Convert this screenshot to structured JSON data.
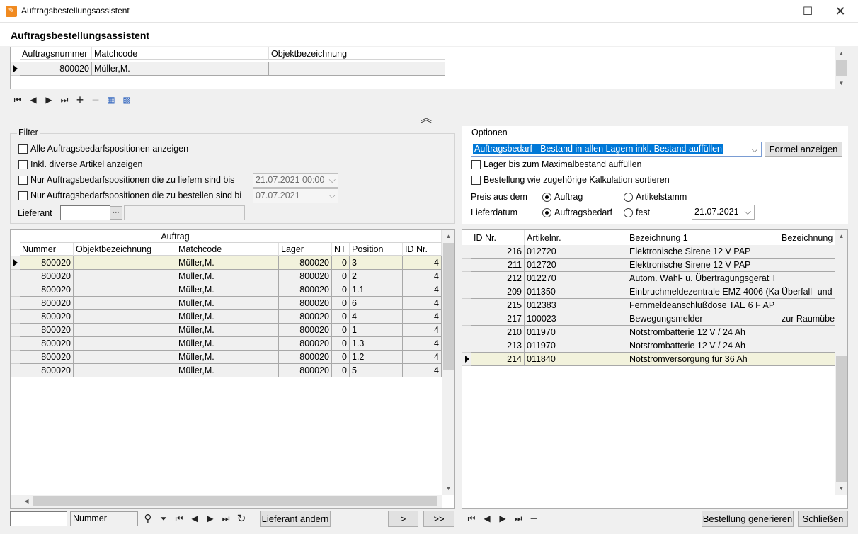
{
  "window": {
    "title": "Auftragsbestellungsassistent",
    "icon": "app-logo-icon"
  },
  "header": {
    "title": "Auftragsbestellungsassistent"
  },
  "order_grid": {
    "columns": [
      "Auftragsnummer",
      "Matchcode",
      "Objektbezeichnung"
    ],
    "rows": [
      {
        "auftragsnummer": "800020",
        "matchcode": "Müller,M.",
        "objektbezeichnung": ""
      }
    ]
  },
  "filter": {
    "legend": "Filter",
    "cb_all": "Alle Auftragsbedarfspositionen anzeigen",
    "cb_diverse": "Inkl. diverse Artikel anzeigen",
    "cb_liefern": "Nur Auftragsbedarfspositionen die zu liefern sind bis",
    "cb_bestellen": "Nur Auftragsbedarfspositionen die zu bestellen sind bi",
    "date_liefern": "21.07.2021 00:00",
    "date_bestellen": "07.07.2021",
    "lieferant_label": "Lieferant",
    "lieferant_browse": "···"
  },
  "left_grid": {
    "group_header": "Auftrag",
    "columns": [
      "Nummer",
      "Objektbezeichnung",
      "Matchcode",
      "Lager",
      "NT",
      "Position",
      "ID Nr."
    ],
    "rows": [
      {
        "nummer": "800020",
        "objekt": "",
        "matchcode": "Müller,M.",
        "lager": "800020",
        "nt": "0",
        "position": "3",
        "id": "4"
      },
      {
        "nummer": "800020",
        "objekt": "",
        "matchcode": "Müller,M.",
        "lager": "800020",
        "nt": "0",
        "position": "2",
        "id": "4"
      },
      {
        "nummer": "800020",
        "objekt": "",
        "matchcode": "Müller,M.",
        "lager": "800020",
        "nt": "0",
        "position": "1.1",
        "id": "4"
      },
      {
        "nummer": "800020",
        "objekt": "",
        "matchcode": "Müller,M.",
        "lager": "800020",
        "nt": "0",
        "position": "6",
        "id": "4"
      },
      {
        "nummer": "800020",
        "objekt": "",
        "matchcode": "Müller,M.",
        "lager": "800020",
        "nt": "0",
        "position": "4",
        "id": "4"
      },
      {
        "nummer": "800020",
        "objekt": "",
        "matchcode": "Müller,M.",
        "lager": "800020",
        "nt": "0",
        "position": "1",
        "id": "4"
      },
      {
        "nummer": "800020",
        "objekt": "",
        "matchcode": "Müller,M.",
        "lager": "800020",
        "nt": "0",
        "position": "1.3",
        "id": "4"
      },
      {
        "nummer": "800020",
        "objekt": "",
        "matchcode": "Müller,M.",
        "lager": "800020",
        "nt": "0",
        "position": "1.2",
        "id": "4"
      },
      {
        "nummer": "800020",
        "objekt": "",
        "matchcode": "Müller,M.",
        "lager": "800020",
        "nt": "0",
        "position": "5",
        "id": "4"
      }
    ]
  },
  "options": {
    "legend": "Optionen",
    "dropdown_value": "Auftragsbedarf - Bestand in allen Lagern inkl. Bestand auffüllen",
    "formel_button": "Formel anzeigen",
    "cb_lager": "Lager bis zum Maximalbestand auffüllen",
    "cb_sort": "Bestellung wie zugehörige Kalkulation sortieren",
    "preis_label": "Preis aus dem",
    "preis_opt1": "Auftrag",
    "preis_opt2": "Artikelstamm",
    "lieferdatum_label": "Lieferdatum",
    "liefer_opt1": "Auftragsbedarf",
    "liefer_opt2": "fest",
    "liefer_date": "21.07.2021"
  },
  "right_grid": {
    "columns": [
      "ID Nr.",
      "Artikelnr.",
      "Bezeichnung 1",
      "Bezeichnung"
    ],
    "rows": [
      {
        "id": "216",
        "art": "012720",
        "bez1": "Elektronische Sirene 12 V PAP",
        "bez2": ""
      },
      {
        "id": "211",
        "art": "012720",
        "bez1": "Elektronische Sirene 12 V PAP",
        "bez2": ""
      },
      {
        "id": "212",
        "art": "012270",
        "bez1": "Autom. Wähl- u. Übertragungsgerät T",
        "bez2": ""
      },
      {
        "id": "209",
        "art": "011350",
        "bez1": "Einbruchmeldezentrale EMZ 4006 (Ka",
        "bez2": "Überfall- und"
      },
      {
        "id": "215",
        "art": "012383",
        "bez1": "Fernmeldeanschlußdose TAE 6 F AP",
        "bez2": ""
      },
      {
        "id": "217",
        "art": "100023",
        "bez1": "Bewegungsmelder",
        "bez2": "zur Raumübe"
      },
      {
        "id": "210",
        "art": "011970",
        "bez1": "Notstrombatterie 12 V / 24 Ah",
        "bez2": ""
      },
      {
        "id": "213",
        "art": "011970",
        "bez1": "Notstrombatterie 12 V / 24 Ah",
        "bez2": ""
      },
      {
        "id": "214",
        "art": "011840",
        "bez1": "Notstromversorgung für 36 Ah",
        "bez2": ""
      }
    ]
  },
  "bottom": {
    "search_value": "",
    "search_field": "Nummer",
    "lieferant_aendern": "Lieferant ändern",
    "next": ">",
    "next_all": ">>",
    "generate": "Bestellung generieren",
    "close": "Schließen"
  }
}
